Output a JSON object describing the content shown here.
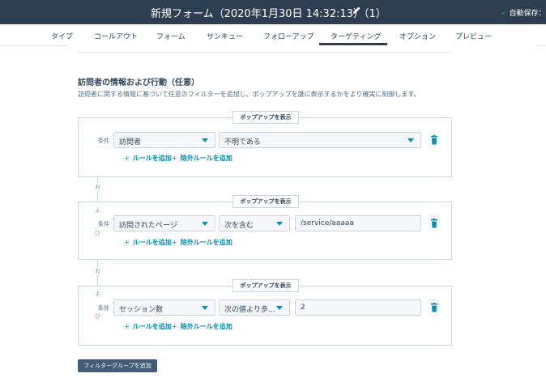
{
  "header": {
    "title": "新規フォーム（2020年1月30日 14:32:13）（1）",
    "autosave": "自動保存：ま"
  },
  "tabs": [
    {
      "label": "タイプ"
    },
    {
      "label": "コールアウト"
    },
    {
      "label": "フォーム"
    },
    {
      "label": "サンキュー"
    },
    {
      "label": "フォローアップ"
    },
    {
      "label": "ターゲティング",
      "active": true
    },
    {
      "label": "オプション"
    },
    {
      "label": "プレビュー"
    }
  ],
  "section": {
    "title": "訪問者の情報および行動（任意）",
    "description": "訪問者に関する情報に基づいて任意のフィルターを追加し、ポップアップを誰に表示するかをより確実に制御します。"
  },
  "groups": [
    {
      "badge": "ポップアップを表示",
      "condition_label": "条件",
      "field": "訪問者",
      "operator": "不明である",
      "add_rule": "ルールを追加",
      "add_exclusion": "除外ルールを追加"
    },
    {
      "badge": "ポップアップを表示",
      "condition_label": "条件",
      "field": "訪問されたページ",
      "operator": "次を含む",
      "value": "/service/aaaaa",
      "add_rule": "ルールを追加",
      "add_exclusion": "除外ルールを追加"
    },
    {
      "badge": "ポップアップを表示",
      "condition_label": "条件",
      "field": "セッション数",
      "operator": "次の値より多...",
      "value": "2",
      "add_rule": "ルールを追加",
      "add_exclusion": "除外ルールを追加"
    }
  ],
  "connectors": [
    {
      "top": "お",
      "left": "よ",
      "bottom": "び"
    },
    {
      "top": "お",
      "left": "よ",
      "bottom": "び"
    }
  ],
  "add_group_button": "フィルターグループを追加",
  "colors": {
    "topbar": "#2d3e50",
    "accent": "#0091ae",
    "button": "#425b76",
    "check": "#00bda5"
  }
}
